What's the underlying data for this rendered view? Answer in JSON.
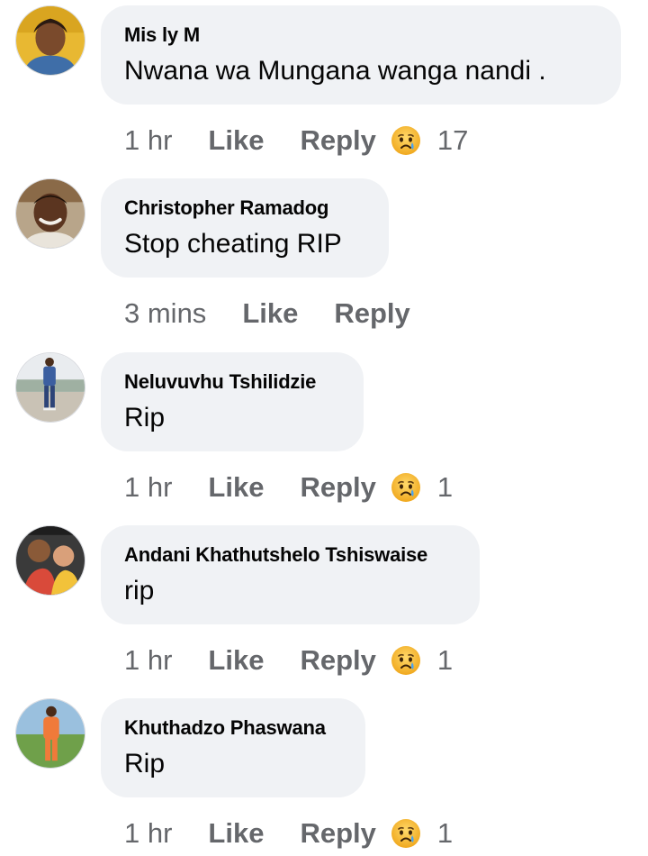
{
  "comments": [
    {
      "author": "Mis ly M",
      "text": "Nwana wa Mungana wanga nandi .",
      "time": "1 hr",
      "like_label": "Like",
      "reply_label": "Reply",
      "reaction_icon": "crying-face-icon",
      "reaction_count": "17"
    },
    {
      "author": "Christopher Ramadog",
      "text": "Stop cheating RIP",
      "time": "3 mins",
      "like_label": "Like",
      "reply_label": "Reply",
      "reaction_icon": null,
      "reaction_count": null
    },
    {
      "author": "Neluvuvhu Tshilidzie",
      "text": "Rip",
      "time": "1 hr",
      "like_label": "Like",
      "reply_label": "Reply",
      "reaction_icon": "crying-face-icon",
      "reaction_count": "1"
    },
    {
      "author": "Andani Khathutshelo Tshiswaise",
      "text": "rip",
      "time": "1 hr",
      "like_label": "Like",
      "reply_label": "Reply",
      "reaction_icon": "crying-face-icon",
      "reaction_count": "1"
    },
    {
      "author": "Khuthadzo Phaswana",
      "text": "Rip",
      "time": "1 hr",
      "like_label": "Like",
      "reply_label": "Reply",
      "reaction_icon": "crying-face-icon",
      "reaction_count": "1"
    }
  ],
  "colors": {
    "bubble_background": "#f0f2f5",
    "secondary_text": "#65676b",
    "primary_text": "#050505",
    "reaction_face": "#f7b125"
  }
}
